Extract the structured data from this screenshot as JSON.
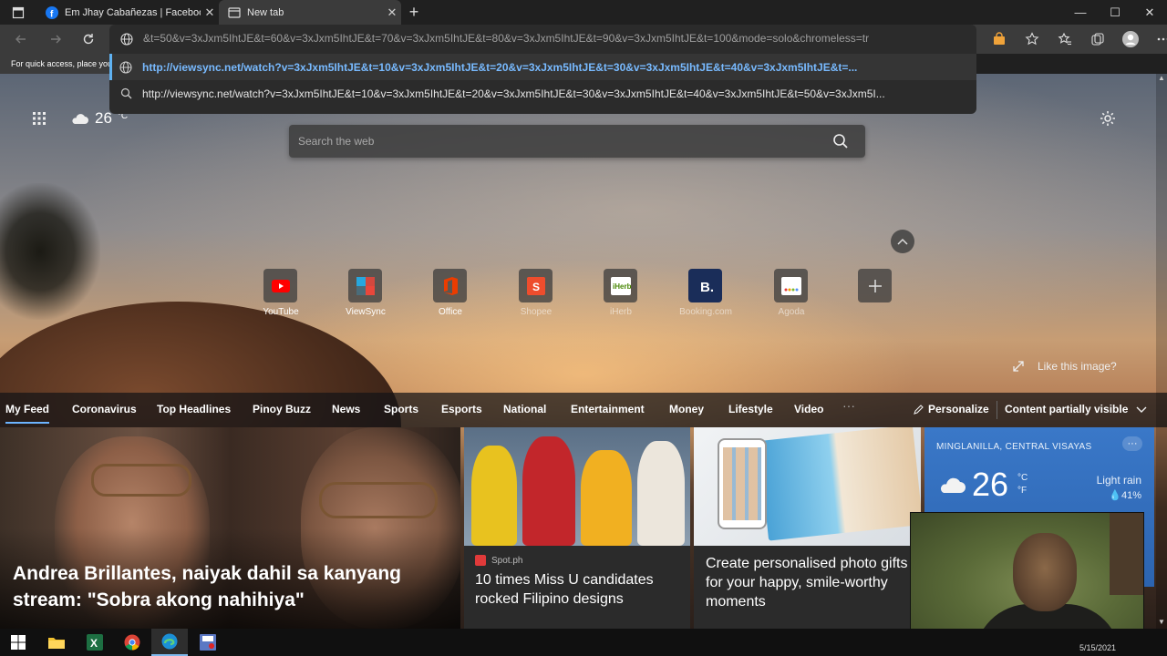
{
  "tabs": [
    {
      "title": "Em Jhay Cabañezas | Facebook",
      "close": "✕"
    },
    {
      "title": "New tab",
      "close": "✕"
    }
  ],
  "new_tab_symbol": "+",
  "window_controls": {
    "minimize": "—",
    "maximize": "☐",
    "close": "✕"
  },
  "address_bar": {
    "value": "&t=50&v=3xJxm5IhtJE&t=60&v=3xJxm5IhtJE&t=70&v=3xJxm5IhtJE&t=80&v=3xJxm5IhtJE&t=90&v=3xJxm5IhtJE&t=100&mode=solo&chromeless=tr"
  },
  "favorites_hint": "For quick access, place your favorites here on the favorites bar.",
  "suggestions": [
    {
      "text": "http://viewsync.net/watch?v=3xJxm5IhtJE&t=10&v=3xJxm5IhtJE&t=20&v=3xJxm5IhtJE&t=30&v=3xJxm5IhtJE&t=40&v=3xJxm5IhtJE&t=...",
      "icon": "globe-icon"
    },
    {
      "text": "http://viewsync.net/watch?v=3xJxm5IhtJE&t=10&v=3xJxm5IhtJE&t=20&v=3xJxm5IhtJE&t=30&v=3xJxm5IhtJE&t=40&v=3xJxm5IhtJE&t=50&v=3xJxm5I...",
      "icon": "search-icon"
    }
  ],
  "weather_mini": {
    "temp": "26",
    "unit": "°C"
  },
  "search": {
    "placeholder": "Search the web"
  },
  "quick_links": [
    {
      "label": "YouTube",
      "icon": "youtube-icon"
    },
    {
      "label": "ViewSync",
      "icon": "viewsync-icon"
    },
    {
      "label": "Office",
      "icon": "office-icon"
    },
    {
      "label": "Shopee",
      "icon": "shopee-icon"
    },
    {
      "label": "iHerb",
      "icon": "iherb-icon"
    },
    {
      "label": "Booking.com",
      "icon": "booking-icon"
    },
    {
      "label": "Agoda",
      "icon": "agoda-icon"
    }
  ],
  "like_image": "Like this image?",
  "feed_nav": {
    "items": [
      "My Feed",
      "Coronavirus",
      "Top Headlines",
      "Pinoy Buzz",
      "News",
      "Sports",
      "Esports",
      "National",
      "Entertainment",
      "Money",
      "Lifestyle",
      "Video"
    ],
    "more": "···",
    "personalize": "Personalize",
    "content_visibility": "Content partially visible"
  },
  "cards": {
    "main": {
      "headline": "Andrea Brillantes, naiyak dahil sa kanyang stream: \"Sobra akong nahihiya\""
    },
    "mid": {
      "source": "Spot.ph",
      "headline": "10 times Miss U candidates rocked Filipino designs"
    },
    "ad": {
      "headline": "Create personalised photo gifts for your happy, smile-worthy moments"
    }
  },
  "weather_card": {
    "location": "MINGLANILLA, CENTRAL VISAYAS",
    "temp": "26",
    "unit_c": "°C",
    "unit_f": "°F",
    "condition": "Light rain",
    "precip": "41%"
  },
  "taskbar": {
    "date": "5/15/2021"
  },
  "colors": {
    "accent": "#6cb4ff",
    "suggestion_link": "#78baff",
    "weather_card": "#3a78c8"
  }
}
